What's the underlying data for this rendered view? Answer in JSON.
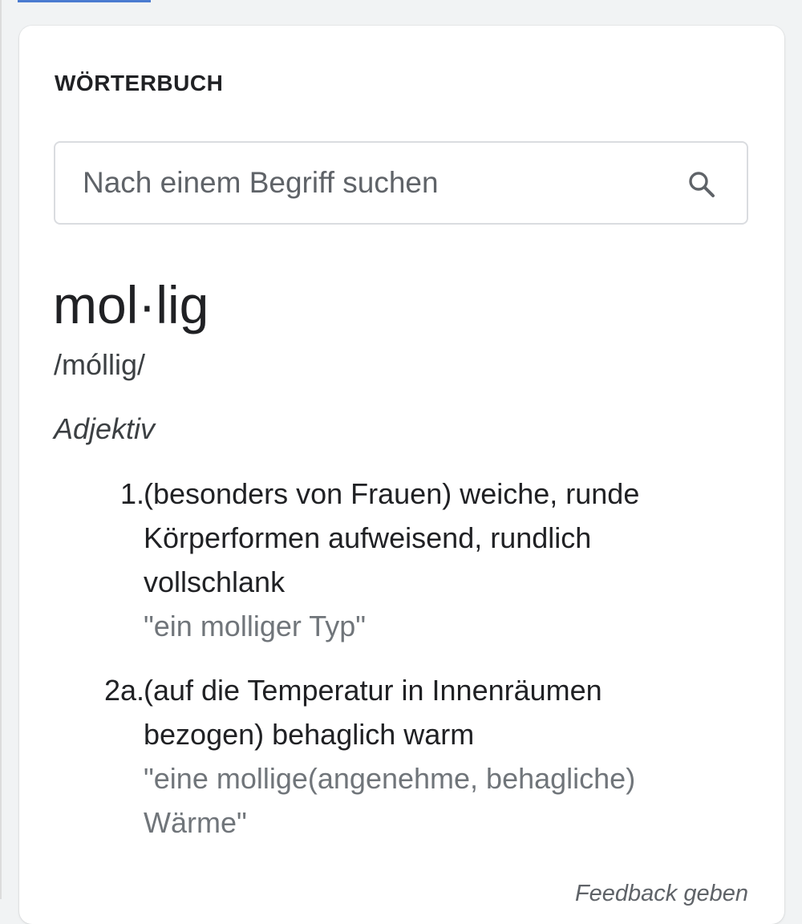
{
  "dictionary": {
    "title": "WÖRTERBUCH",
    "search": {
      "placeholder": "Nach einem Begriff suchen",
      "value": ""
    },
    "entry": {
      "headword": "mol·lig",
      "pronunciation": "/móllig/",
      "part_of_speech": "Adjektiv",
      "senses": [
        {
          "number": "1.",
          "definition": "(besonders von Frauen) weiche, runde Körperformen aufweisend, rundlich vollschlank",
          "example": "\"ein molliger Typ\""
        },
        {
          "number": "2a.",
          "definition": "(auf die Temperatur in Innenräumen bezogen) behaglich warm",
          "example": "\"eine mollige(angenehme, behagliche) Wärme\""
        }
      ]
    },
    "feedback_label": "Feedback geben"
  },
  "icons": {
    "search": "search-icon"
  },
  "colors": {
    "text_primary": "#202124",
    "text_secondary": "#70757a",
    "border": "#dadce0",
    "accent": "#4a7bd0"
  }
}
